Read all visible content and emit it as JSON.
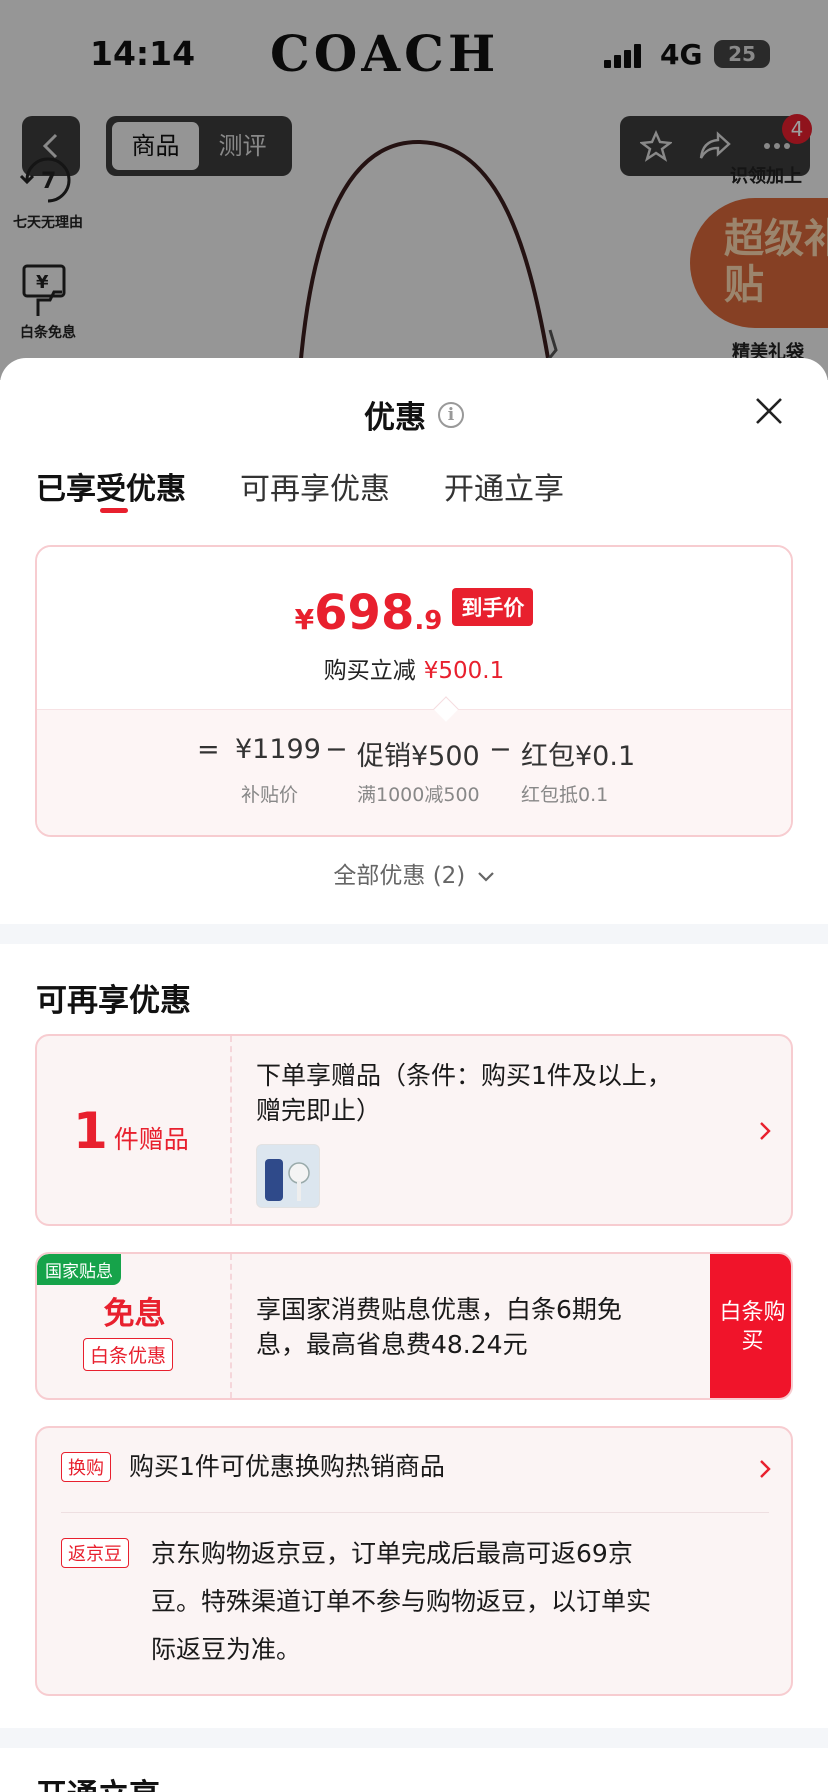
{
  "status_bar": {
    "time": "14:14",
    "network": "4G",
    "battery": "25"
  },
  "background": {
    "brand": "COACH",
    "tabs": [
      "商品",
      "测评"
    ],
    "cart_count": "4",
    "side_items": [
      "七天无理由",
      "白条免息"
    ],
    "subsidy_badge": "超级补贴",
    "right_tag_top": "识领加上",
    "right_tag_bottom": "精美礼袋"
  },
  "sheet": {
    "title": "优惠",
    "tabs": [
      "已享受优惠",
      "可再享优惠",
      "开通立享"
    ],
    "price_card": {
      "currency": "¥",
      "price_int": "698",
      "price_dec": ".9",
      "price_tag": "到手价",
      "save_label": "购买立减",
      "save_amount": "¥500.1",
      "equals": "=",
      "minus": "−",
      "items": [
        {
          "value": "¥1199",
          "sub": "补贴价"
        },
        {
          "value": "促销¥500",
          "sub": "满1000减500"
        },
        {
          "value": "红包¥0.1",
          "sub": "红包抵0.1"
        }
      ]
    },
    "all_offers": "全部优惠 (2)",
    "more_section_title": "可再享优惠",
    "gift_card": {
      "count": "1",
      "unit": "件赠品",
      "desc_line1": "下单享赠品（条件：购买1件及以上，",
      "desc_line2": "赠完即止）"
    },
    "interest_card": {
      "badge": "国家贴息",
      "title": "免息",
      "sub": "白条优惠",
      "desc_line1": "享国家消费贴息优惠，白条6期免",
      "desc_line2": "息，最高省息费48.24元",
      "button": "白条购买"
    },
    "misc_card": {
      "swap_tag": "换购",
      "swap_text": "购买1件可优惠换购热销商品",
      "bean_tag": "返京豆",
      "bean_line1": "京东购物返京豆，订单完成后最高可返69京",
      "bean_line2": "豆。特殊渠道订单不参与购物返豆，以订单实",
      "bean_line3": "际返豆为准。"
    },
    "next_section_title": "开通立享"
  },
  "colors": {
    "accent_red": "#e8202e",
    "gov_green": "#16a34a",
    "card_border": "#f7ccd0"
  }
}
